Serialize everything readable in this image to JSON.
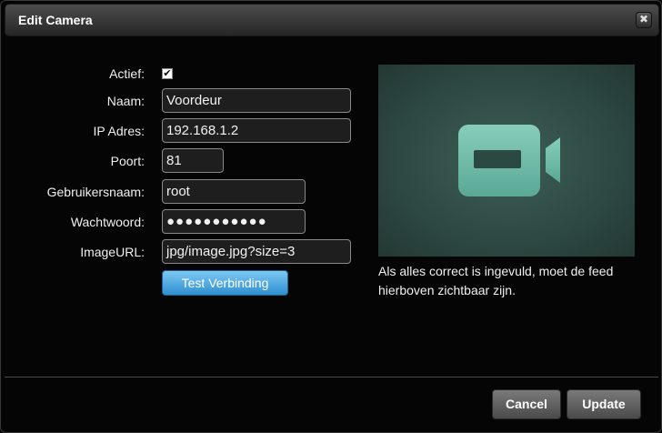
{
  "window": {
    "title": "Edit Camera",
    "close_symbol": "✖"
  },
  "form": {
    "active": {
      "label": "Actief:",
      "checked": true,
      "check_symbol": "✔"
    },
    "name": {
      "label": "Naam:",
      "value": "Voordeur"
    },
    "ip": {
      "label": "IP Adres:",
      "value": "192.168.1.2"
    },
    "port": {
      "label": "Poort:",
      "value": "81"
    },
    "username": {
      "label": "Gebruikersnaam:",
      "value": "root"
    },
    "password": {
      "label": "Wachtwoord:",
      "value": "●●●●●●●●●●●"
    },
    "image_url": {
      "label": "ImageURL:",
      "value": "jpg/image.jpg?size=3"
    },
    "test_button": "Test Verbinding"
  },
  "preview": {
    "icon": "video-camera-icon",
    "hint": "Als alles correct is ingevuld, moet de feed hierboven zichtbaar zijn."
  },
  "footer": {
    "cancel": "Cancel",
    "update": "Update"
  },
  "colors": {
    "accent_blue": "#3a9ad9",
    "preview_bg": "#2f4a44",
    "icon_color": "#6fb8a6"
  }
}
